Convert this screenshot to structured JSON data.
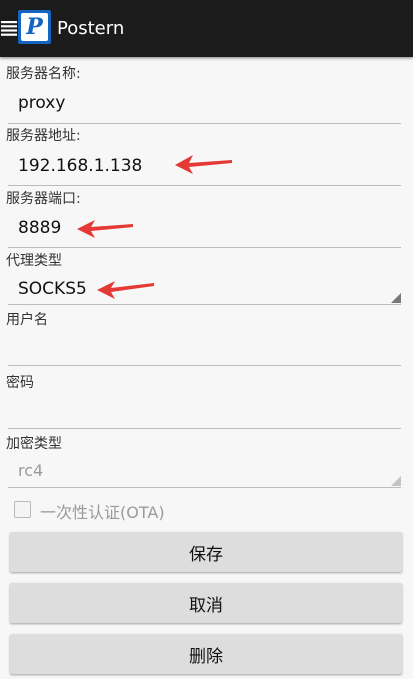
{
  "appbar": {
    "title": "Postern",
    "logo_letter": "P"
  },
  "form": {
    "server_name": {
      "label": "服务器名称:",
      "value": "proxy"
    },
    "server_address": {
      "label": "服务器地址:",
      "value": "192.168.1.138"
    },
    "server_port": {
      "label": "服务器端口:",
      "value": "8889"
    },
    "proxy_type": {
      "label": "代理类型",
      "value": "SOCKS5"
    },
    "username": {
      "label": "用户名",
      "value": ""
    },
    "password": {
      "label": "密码",
      "value": ""
    },
    "encryption": {
      "label": "加密类型",
      "value": "rc4"
    },
    "ota": {
      "label": "一次性认证(OTA)",
      "checked": false
    }
  },
  "buttons": {
    "save": "保存",
    "cancel": "取消",
    "delete": "删除"
  },
  "colors": {
    "appbar": "#1b1b1b",
    "logo": "#1565c0",
    "annotation_arrow": "#e53935"
  }
}
